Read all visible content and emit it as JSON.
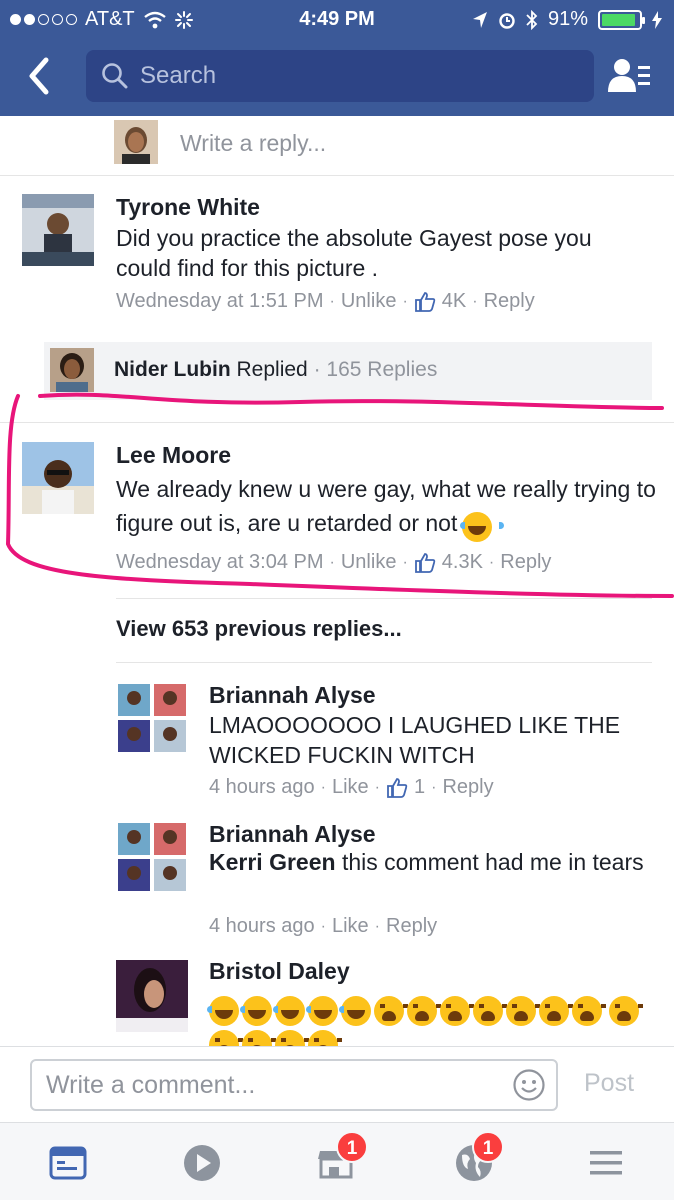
{
  "status_bar": {
    "carrier": "AT&T",
    "time": "4:49 PM",
    "battery": "91%",
    "battery_level": 0.91,
    "signal_bars": 2
  },
  "nav": {
    "search_placeholder": "Search"
  },
  "top_reply_placeholder": "Write a reply...",
  "comments": [
    {
      "name": "Tyrone White",
      "text": "Did you practice the absolute Gayest pose you could find for this picture .",
      "time": "Wednesday at 1:51 PM",
      "action": "Unlike",
      "likes": "4K",
      "reply": "Reply"
    },
    {
      "name": "Lee Moore",
      "text": "We already knew u were gay, what we really trying to figure out is, are u retarded or not",
      "time": "Wednesday at 3:04 PM",
      "action": "Unlike",
      "likes": "4.3K",
      "reply": "Reply"
    }
  ],
  "replied_summary": {
    "name": "Nider Lubin",
    "verb": "Replied",
    "count": "165 Replies"
  },
  "view_previous": "View 653 previous replies...",
  "replies": [
    {
      "name": "Briannah Alyse",
      "text": "LMAOOOOOOO I LAUGHED LIKE THE WICKED FUCKIN WITCH",
      "time": "4 hours ago",
      "action": "Like",
      "likes": "1",
      "reply": "Reply"
    },
    {
      "name": "Briannah Alyse",
      "tag": "Kerri Green",
      "text": "this comment had me in tears",
      "time": "4 hours ago",
      "action": "Like",
      "reply": "Reply"
    },
    {
      "name": "Bristol Daley"
    }
  ],
  "compose": {
    "placeholder": "Write a comment...",
    "post_label": "Post"
  },
  "tabbar": {
    "marketplace_badge": "1",
    "notifications_badge": "1"
  },
  "colors": {
    "header": "#3b5998",
    "link": "#4267b2",
    "annotation": "#e8157a",
    "badge": "#fa3e3e"
  }
}
